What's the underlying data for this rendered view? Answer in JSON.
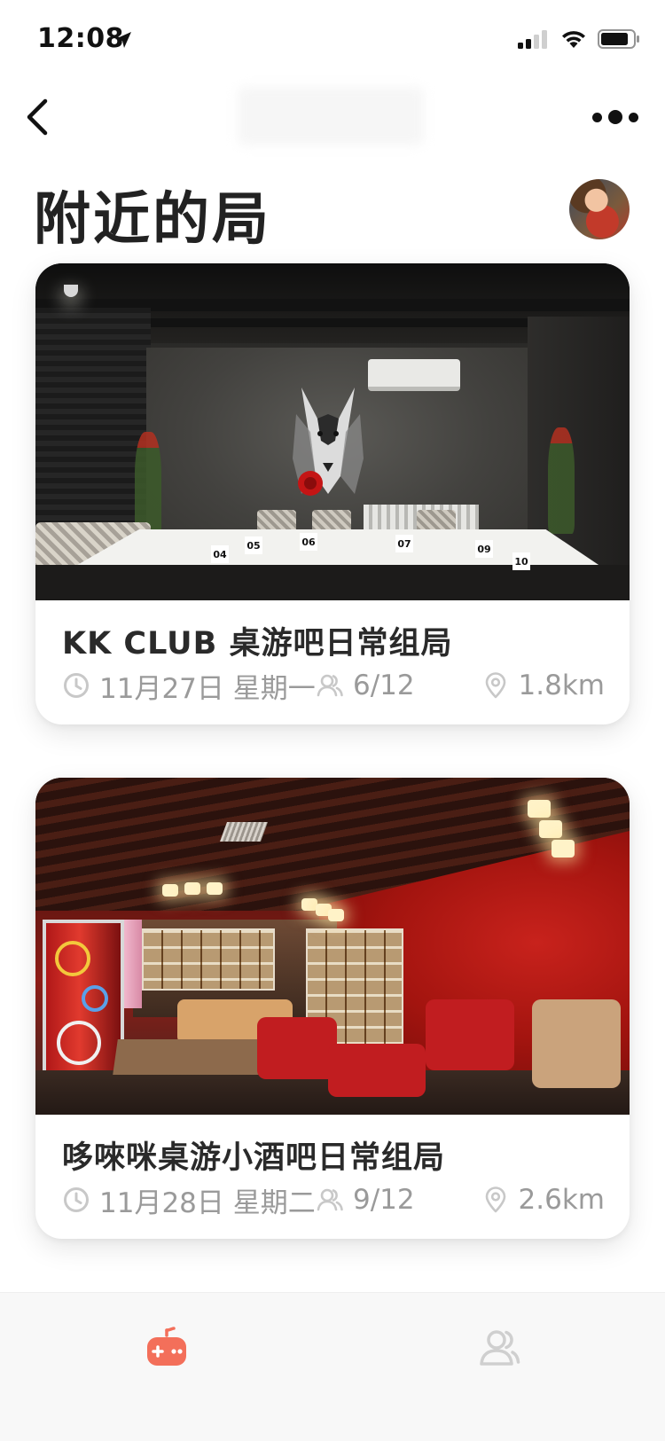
{
  "status_bar": {
    "time": "12:08",
    "icons": [
      "location-arrow-icon",
      "signal-icon",
      "wifi-icon",
      "battery-icon"
    ]
  },
  "nav": {
    "back_icon": "chevron-left-icon",
    "more_icon": "more-dots-icon"
  },
  "header": {
    "title": "附近的局",
    "avatar_icon": "user-avatar"
  },
  "events": [
    {
      "title": "KK CLUB 桌游吧日常组局",
      "date": "11月27日 星期一",
      "participants": "6/12",
      "distance": "1.8km",
      "image": "dark-club-room-wolf-mural"
    },
    {
      "title": "哆唻咪桌游小酒吧日常组局",
      "date": "11月28日 星期二",
      "participants": "9/12",
      "distance": "2.6km",
      "image": "red-bar-room-bookshelves"
    }
  ],
  "tab_bar": {
    "tabs": [
      {
        "icon": "gamepad-icon",
        "active": true,
        "color": "#f36f5a"
      },
      {
        "icon": "friends-icon",
        "active": false,
        "color": "#cfcfcf"
      }
    ]
  },
  "colors": {
    "accent": "#f36f5a",
    "meta_text": "#9a9a9a",
    "title_text": "#222222"
  }
}
